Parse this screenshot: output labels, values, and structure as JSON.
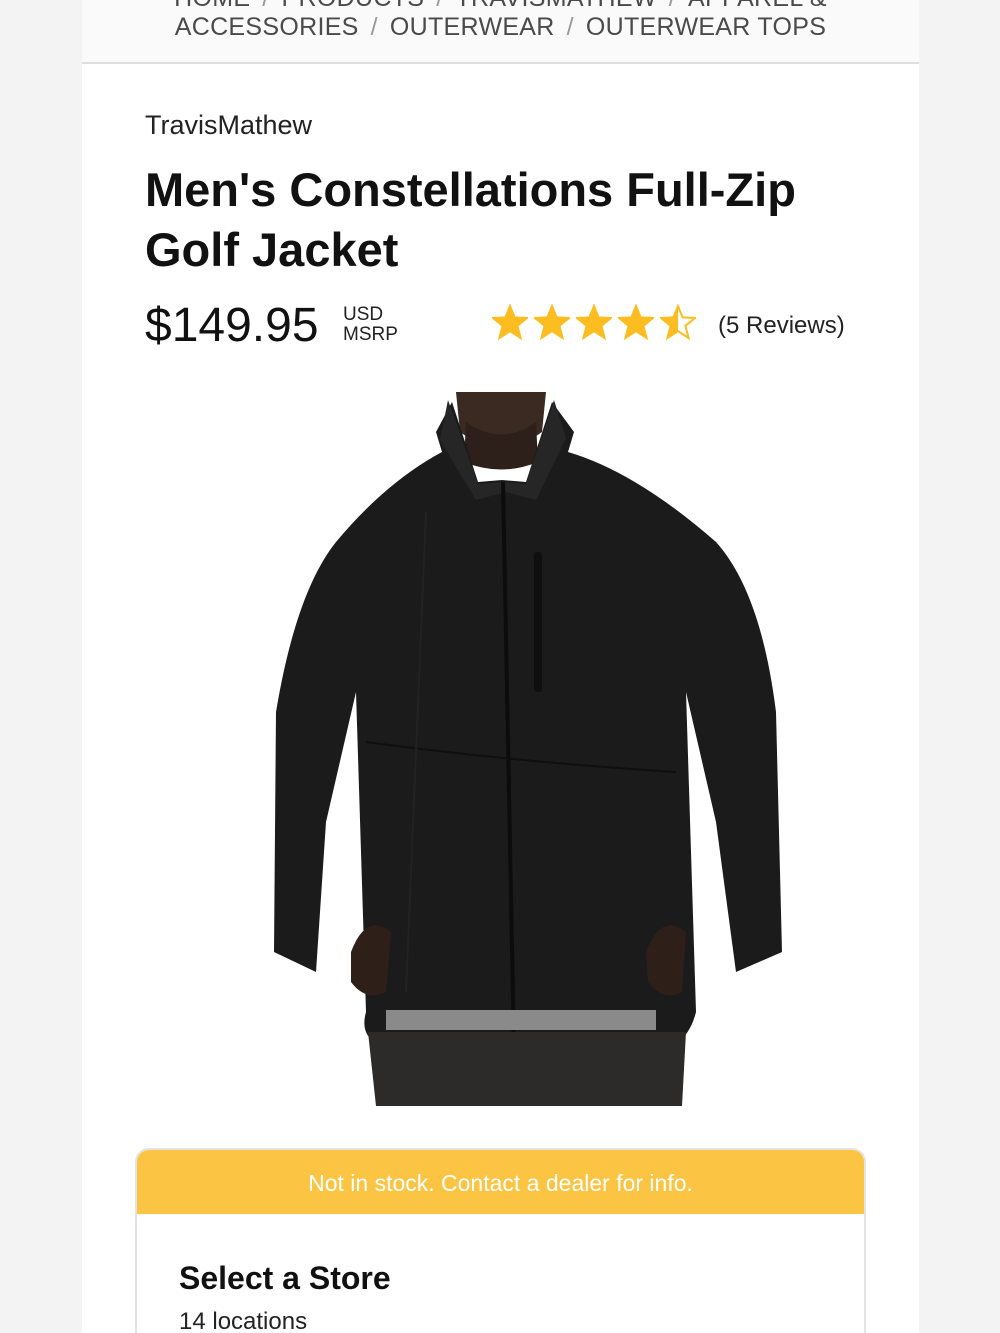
{
  "breadcrumb": {
    "items": [
      "HOME",
      "PRODUCTS",
      "TRAVISMATHEW",
      "APPAREL &",
      "ACCESSORIES",
      "OUTERWEAR",
      "OUTERWEAR TOPS"
    ],
    "separator": "/"
  },
  "product": {
    "brand": "TravisMathew",
    "title": "Men's Constellations Full-Zip Golf Jacket",
    "price": "$149.95",
    "currency": "USD",
    "price_type": "MSRP",
    "rating": 4.5,
    "rating_max": 5,
    "reviews_label": "(5 Reviews)",
    "image_icon": "product-photo-jacket"
  },
  "stock": {
    "banner": "Not in stock. Contact a dealer for info.",
    "select_store_title": "Select a Store",
    "locations": "14 locations"
  },
  "colors": {
    "star": "#fbbd20",
    "banner": "#fbc443"
  }
}
